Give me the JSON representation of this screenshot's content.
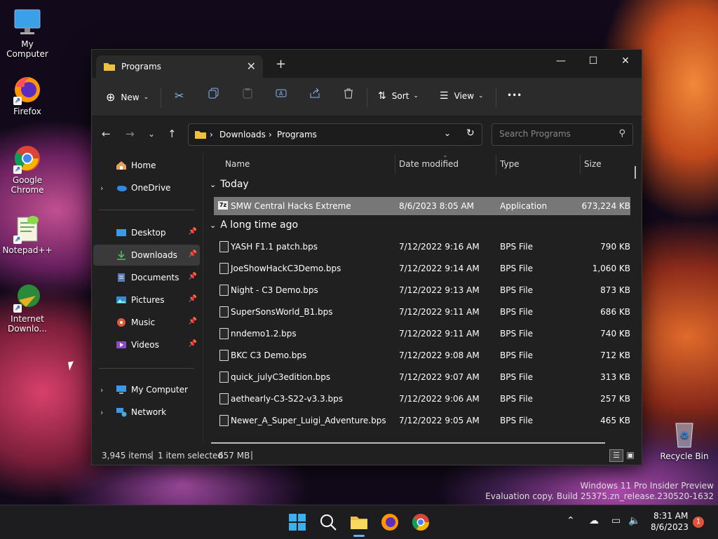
{
  "desktop": {
    "icons": [
      {
        "label": "My Computer"
      },
      {
        "label": "Firefox"
      },
      {
        "label": "Google Chrome"
      },
      {
        "label": "Notepad++"
      },
      {
        "label": "Internet Downlo..."
      },
      {
        "label": "Recycle Bin"
      }
    ],
    "watermark_line1": "Windows 11 Pro Insider Preview",
    "watermark_line2": "Evaluation copy. Build 25375.zn_release.230520-1632"
  },
  "explorer": {
    "tab_title": "Programs",
    "new_tab_label": "+",
    "toolbar": {
      "new_label": "New",
      "sort_label": "Sort",
      "view_label": "View",
      "more_label": "•••"
    },
    "breadcrumb": [
      "Downloads",
      "Programs"
    ],
    "search_placeholder": "Search Programs",
    "sidebar": {
      "home": "Home",
      "onedrive": "OneDrive",
      "desktop": "Desktop",
      "downloads": "Downloads",
      "documents": "Documents",
      "pictures": "Pictures",
      "music": "Music",
      "videos": "Videos",
      "mycomputer": "My Computer",
      "network": "Network"
    },
    "columns": {
      "name": "Name",
      "date": "Date modified",
      "type": "Type",
      "size": "Size"
    },
    "groups": {
      "today": "Today",
      "long_ago": "A long time ago"
    },
    "today_files": [
      {
        "name": "SMW Central Hacks Extreme",
        "date": "8/6/2023 8:05 AM",
        "type": "Application",
        "size": "673,224 KB"
      }
    ],
    "old_files": [
      {
        "name": "YASH F1.1 patch.bps",
        "date": "7/12/2022 9:16 AM",
        "type": "BPS File",
        "size": "790 KB"
      },
      {
        "name": "JoeShowHackC3Demo.bps",
        "date": "7/12/2022 9:14 AM",
        "type": "BPS File",
        "size": "1,060 KB"
      },
      {
        "name": "Night - C3 Demo.bps",
        "date": "7/12/2022 9:13 AM",
        "type": "BPS File",
        "size": "873 KB"
      },
      {
        "name": "SuperSonsWorld_B1.bps",
        "date": "7/12/2022 9:11 AM",
        "type": "BPS File",
        "size": "686 KB"
      },
      {
        "name": "nndemo1.2.bps",
        "date": "7/12/2022 9:11 AM",
        "type": "BPS File",
        "size": "740 KB"
      },
      {
        "name": "BKC C3 Demo.bps",
        "date": "7/12/2022 9:08 AM",
        "type": "BPS File",
        "size": "712 KB"
      },
      {
        "name": "quick_julyC3edition.bps",
        "date": "7/12/2022 9:07 AM",
        "type": "BPS File",
        "size": "313 KB"
      },
      {
        "name": "aethearly-C3-S22-v3.3.bps",
        "date": "7/12/2022 9:06 AM",
        "type": "BPS File",
        "size": "257 KB"
      },
      {
        "name": "Newer_A_Super_Luigi_Adventure.bps",
        "date": "7/12/2022 9:05 AM",
        "type": "BPS File",
        "size": "465 KB"
      }
    ],
    "status": {
      "items": "3,945 items",
      "selected": "1 item selected",
      "size": "657 MB"
    }
  },
  "taskbar": {
    "time": "8:31 AM",
    "date": "8/6/2023",
    "notification_count": "1"
  },
  "colors": {
    "accent": "#0078d4",
    "window_bg": "#202020",
    "selected_row": "#777777"
  }
}
